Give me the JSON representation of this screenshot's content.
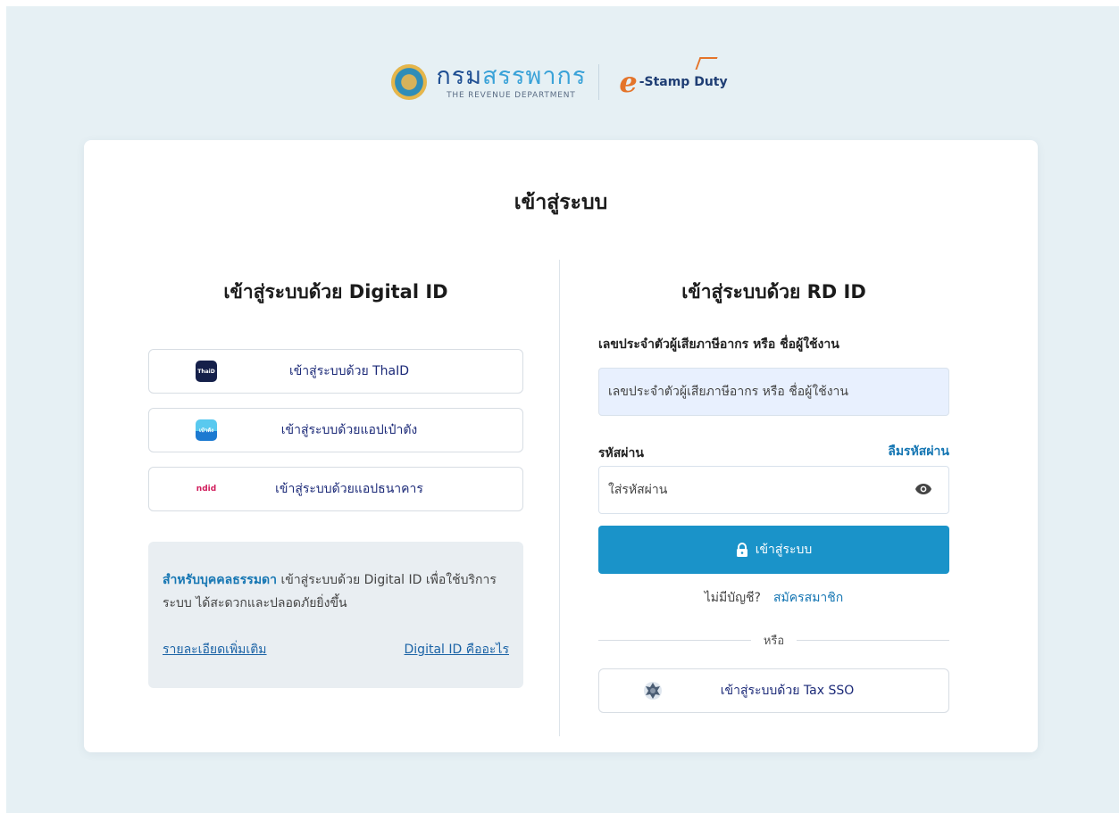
{
  "header": {
    "rd_name_part1": "กรม",
    "rd_name_part2": "สรรพากร",
    "rd_subtitle": "THE REVENUE DEPARTMENT",
    "estamp_e": "e",
    "estamp_text": "-Stamp Duty"
  },
  "card": {
    "title": "เข้าสู่ระบบ"
  },
  "digital_id": {
    "title": "เข้าสู่ระบบด้วย Digital ID",
    "buttons": [
      {
        "label": "เข้าสู่ระบบด้วย ThaID",
        "icon": "thaid-icon",
        "icon_text": "ThaiD"
      },
      {
        "label": "เข้าสู่ระบบด้วยแอปเป๋าตัง",
        "icon": "paotang-icon",
        "icon_text": "เป๋าตัง"
      },
      {
        "label": "เข้าสู่ระบบด้วยแอปธนาคาร",
        "icon": "bank-app-icon",
        "icon_text": "ndid"
      }
    ],
    "info": {
      "strong": "สำหรับบุคคลธรรมดา",
      "text": " เข้าสู่ระบบด้วย Digital ID เพื่อใช้บริการระบบ ได้สะดวกและปลอดภัยยิ่งขึ้น",
      "more_link": "รายละเอียดเพิ่มเติม",
      "what_link": "Digital ID คืออะไร"
    }
  },
  "rd_id": {
    "title": "เข้าสู่ระบบด้วย RD ID",
    "username_label": "เลขประจำตัวผู้เสียภาษีอากร หรือ ชื่อผู้ใช้งาน",
    "username_placeholder": "เลขประจำตัวผู้เสียภาษีอากร หรือ ชื่อผู้ใช้งาน",
    "password_label": "รหัสผ่าน",
    "forgot_password": "ลืมรหัสผ่าน",
    "password_placeholder": "ใส่รหัสผ่าน",
    "login_button": "เข้าสู่ระบบ",
    "no_account": "ไม่มีบัญชี?",
    "register": "สมัครสมาชิก",
    "or": "หรือ",
    "sso_button": "เข้าสู่ระบบด้วย Tax SSO"
  },
  "colors": {
    "primary": "#1a93c9",
    "link": "#1576b3",
    "button_text": "#1c2a78",
    "background": "#e6f0f4"
  }
}
